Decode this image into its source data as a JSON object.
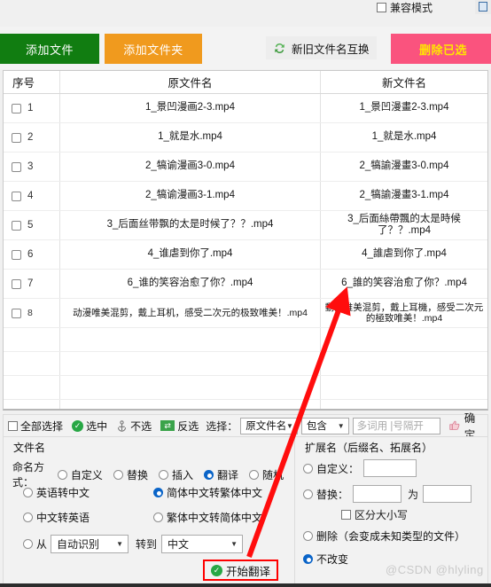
{
  "top": {
    "compat_label": "兼容模式"
  },
  "toolbar": {
    "add_file": "添加文件",
    "add_folder": "添加文件夹",
    "swap_label": "新旧文件名互换",
    "delete_selected": "删除已选"
  },
  "table": {
    "headers": {
      "index": "序号",
      "old_name": "原文件名",
      "new_name": "新文件名"
    },
    "rows": [
      {
        "index": "1",
        "old": "1_景凹漫画2-3.mp4",
        "new": "1_景凹漫畫2-3.mp4",
        "two_line": false
      },
      {
        "index": "2",
        "old": "1_就是水.mp4",
        "new": "1_就是水.mp4",
        "two_line": false
      },
      {
        "index": "3",
        "old": "2_犒谕漫画3-0.mp4",
        "new": "2_犒諭漫畫3-0.mp4",
        "two_line": false
      },
      {
        "index": "4",
        "old": "2_犒谕漫画3-1.mp4",
        "new": "2_犒諭漫畫3-1.mp4",
        "two_line": false
      },
      {
        "index": "5",
        "old": "3_后面丝带飘的太是时候了？？.mp4",
        "new": "3_后面絲帶飄的太是時候了？？.mp4",
        "two_line": false
      },
      {
        "index": "6",
        "old": "4_谁虐到你了.mp4",
        "new": "4_誰虐到你了.mp4",
        "two_line": false
      },
      {
        "index": "7",
        "old": "6_谁的笑容治愈了你？.mp4",
        "new": "6_誰的笑容治愈了你？.mp4",
        "two_line": false
      },
      {
        "index": "8",
        "old": "动漫唯美混剪，戴上耳机，感受二次元的极致唯美！.mp4",
        "new": "動漫唯美混剪，戴上耳機，感受二次元的極致唯美！.mp4",
        "two_line": true
      }
    ],
    "empty_rows": 5
  },
  "select_bar": {
    "select_all": "全部选择",
    "check": "选中",
    "uncheck": "不选",
    "invert": "反选",
    "select_label": "选择：",
    "field_value": "原文件名",
    "mode_value": "包含",
    "keyword_placeholder": "多词用 |号隔开",
    "keyword_value": "",
    "confirm": "确定"
  },
  "filename_panel": {
    "title": "文件名",
    "naming_label": "命名方式：",
    "naming_options": [
      {
        "label": "自定义",
        "selected": false
      },
      {
        "label": "替换",
        "selected": false
      },
      {
        "label": "插入",
        "selected": false
      },
      {
        "label": "翻译",
        "selected": true
      },
      {
        "label": "随机",
        "selected": false
      }
    ],
    "translate_options": [
      {
        "label": "英语转中文",
        "selected": false
      },
      {
        "label": "简体中文转繁体中文",
        "selected": true
      },
      {
        "label": "中文转英语",
        "selected": false
      },
      {
        "label": "繁体中文转简体中文",
        "selected": false
      }
    ],
    "from_radio_label": "从",
    "from_value": "自动识别",
    "to_label": "转到",
    "to_value": "中文",
    "start_button": "开始翻译"
  },
  "ext_panel": {
    "title": "扩展名（后缀名、拓展名）",
    "custom_label": "自定义：",
    "custom_value": "",
    "replace_label": "替换：",
    "replace_from": "",
    "replace_to": "",
    "wei_label": "为",
    "case_label": "区分大小写",
    "delete_label": "删除（会变成未知类型的文件）",
    "keep_label": "不改变",
    "selected": "keep"
  },
  "watermark": "@CSDN @hlyling"
}
